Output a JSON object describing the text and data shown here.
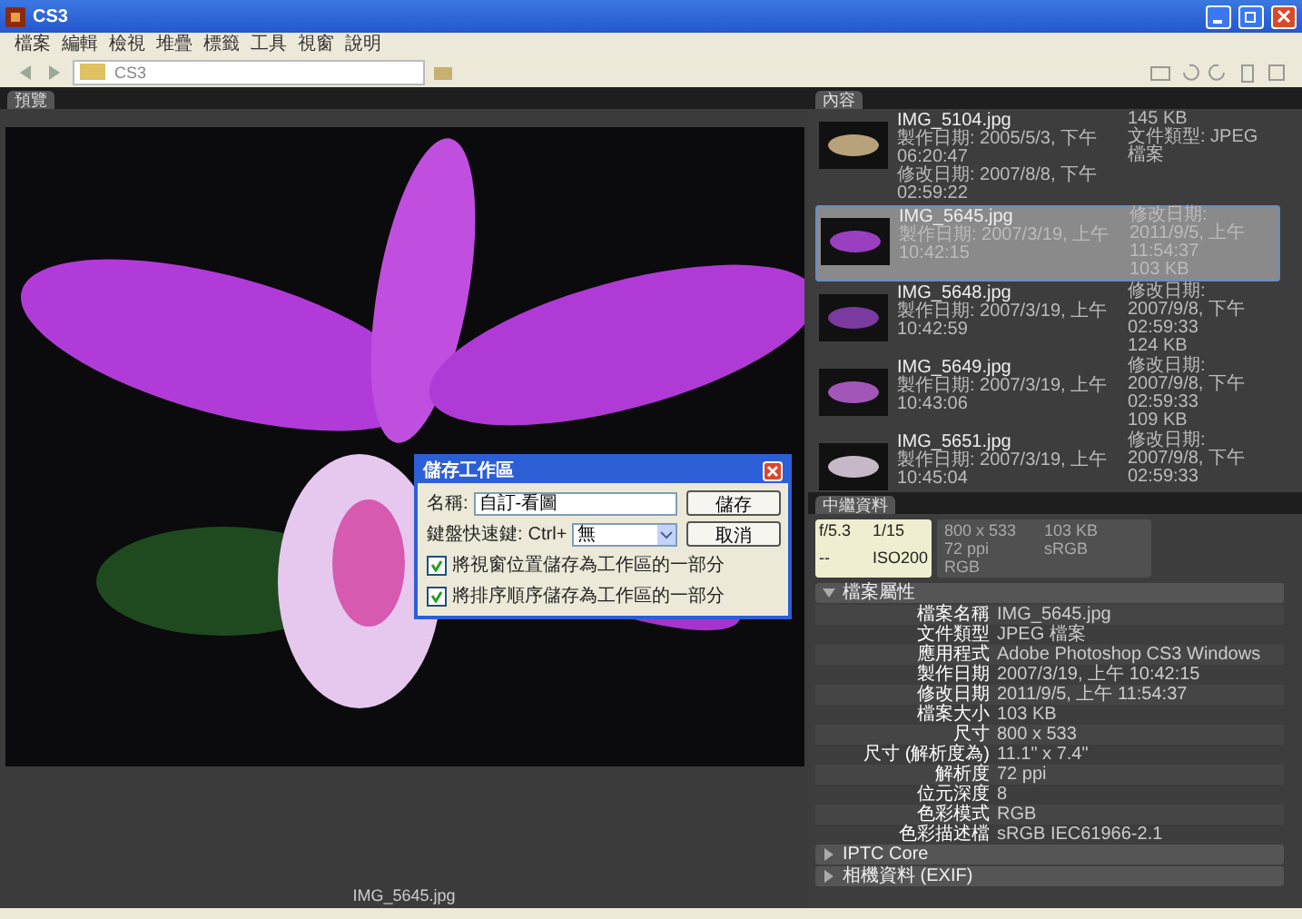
{
  "window": {
    "title": "CS3"
  },
  "menu": [
    "檔案",
    "編輯",
    "檢視",
    "堆疊",
    "標籤",
    "工具",
    "視窗",
    "說明"
  ],
  "toolbar": {
    "path": "CS3"
  },
  "preview": {
    "tab": "預覽",
    "caption": "IMG_5645.jpg"
  },
  "dialog": {
    "title": "儲存工作區",
    "name_label": "名稱:",
    "name_value": "自訂-看圖",
    "shortcut_label": "鍵盤快速鍵:",
    "modifier": "Ctrl+",
    "shortcut_value": "無",
    "buttons": [
      "儲存",
      "取消"
    ],
    "options": [
      {
        "label": "將視窗位置儲存為工作區的一部分",
        "checked": true
      },
      {
        "label": "將排序順序儲存為工作區的一部分",
        "checked": true
      }
    ]
  },
  "content": {
    "tab": "內容",
    "items": [
      {
        "name": "IMG_5104.jpg",
        "created": "製作日期: 2005/5/3, 下午 06:20:47",
        "modified": "修改日期: 2007/8/8, 下午 02:59:22",
        "side": [
          "145 KB",
          "文件類型: JPEG 檔案"
        ],
        "selected": false
      },
      {
        "name": "IMG_5645.jpg",
        "created": "製作日期: 2007/3/19, 上午 10:42:15",
        "side": [
          "修改日期:",
          "2011/9/5, 上午 11:54:37",
          "103 KB"
        ],
        "selected": true
      },
      {
        "name": "IMG_5648.jpg",
        "created": "製作日期: 2007/3/19, 上午 10:42:59",
        "side": [
          "修改日期:",
          "2007/9/8, 下午 02:59:33",
          "124 KB"
        ],
        "selected": false
      },
      {
        "name": "IMG_5649.jpg",
        "created": "製作日期: 2007/3/19, 上午 10:43:06",
        "side": [
          "修改日期:",
          "2007/9/8, 下午 02:59:33",
          "109 KB"
        ],
        "selected": false
      },
      {
        "name": "IMG_5651.jpg",
        "created": "製作日期: 2007/3/19, 上午 10:45:04",
        "side": [
          "修改日期:",
          "2007/9/8, 下午 02:59:33"
        ],
        "selected": false
      }
    ]
  },
  "metadata": {
    "tab": "中繼資料",
    "camera": [
      "f/5.3",
      "1/15",
      "--",
      "ISO200"
    ],
    "file_summary": [
      "800 x 533",
      "103 KB",
      "72 ppi",
      "sRGB",
      "RGB"
    ],
    "sections": [
      {
        "title": "檔案屬性",
        "expanded": true,
        "rows": [
          {
            "label": "檔案名稱",
            "value": "IMG_5645.jpg"
          },
          {
            "label": "文件類型",
            "value": "JPEG 檔案"
          },
          {
            "label": "應用程式",
            "value": "Adobe Photoshop CS3 Windows"
          },
          {
            "label": "製作日期",
            "value": "2007/3/19, 上午 10:42:15"
          },
          {
            "label": "修改日期",
            "value": "2011/9/5, 上午 11:54:37"
          },
          {
            "label": "檔案大小",
            "value": "103 KB"
          },
          {
            "label": "尺寸",
            "value": "800 x 533"
          },
          {
            "label": "尺寸 (解析度為)",
            "value": "11.1\" x 7.4\""
          },
          {
            "label": "解析度",
            "value": "72 ppi"
          },
          {
            "label": "位元深度",
            "value": "8"
          },
          {
            "label": "色彩模式",
            "value": "RGB"
          },
          {
            "label": "色彩描述檔",
            "value": "sRGB IEC61966-2.1"
          }
        ]
      },
      {
        "title": "IPTC Core",
        "expanded": false
      },
      {
        "title": "相機資料 (EXIF)",
        "expanded": false
      }
    ]
  }
}
